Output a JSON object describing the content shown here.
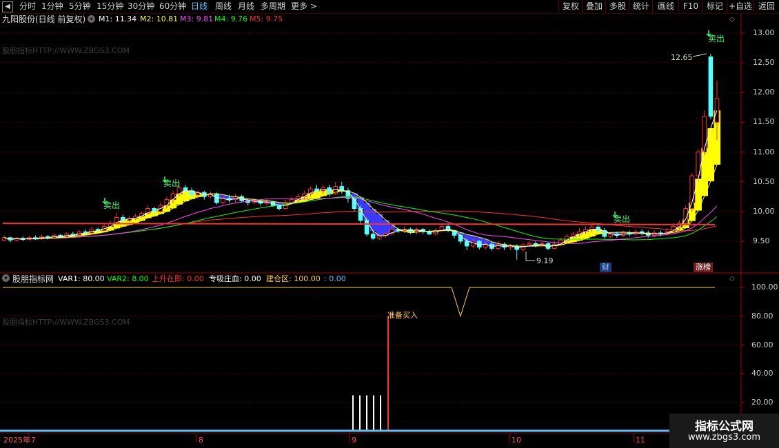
{
  "toolbar": {
    "left_items": [
      "分时",
      "1分钟",
      "5分钟",
      "15分钟",
      "30分钟",
      "60分钟",
      "日线",
      "周线",
      "月线",
      "多周期",
      "更多"
    ],
    "active": "日线",
    "right_items": [
      "复权",
      "叠加",
      "多股",
      "统计",
      "画线",
      "F10",
      "标记",
      "+自选",
      "返回"
    ]
  },
  "main_legend": {
    "stock": "九阳股份(日线 前复权)",
    "m1": "M1: 11.34",
    "m2": "M2: 10.81",
    "m3": "M3: 9.81",
    "m4": "M4: 9.76",
    "m5": "M5: 9.75"
  },
  "sub_legend": {
    "name": "股朋指标网",
    "var1": "VAR1: 80.00",
    "var2": "VAR2: 8.00",
    "rise": "上升在即: 0.00",
    "absorb": "专吸庄血: 0.00",
    "build": "建仓区: 100.00",
    "extra": ": 0.00"
  },
  "watermark": "股朋指标HTTP://WWW.ZBGS3.COM",
  "annotations": {
    "sell": "卖出",
    "high": "12.65",
    "low": "9.19",
    "cai": "财",
    "zhangbang": "涨榜",
    "buy_ready": "准备买入"
  },
  "axis": {
    "price_ticks": [
      "13.00",
      "12.50",
      "12.00",
      "11.50",
      "11.00",
      "10.50",
      "10.00",
      "9.50"
    ],
    "sub_ticks": [
      "100.00",
      "80.00",
      "60.00",
      "40.00",
      "20.00"
    ],
    "dates": [
      "2025年",
      "7",
      "8",
      "9",
      "10",
      "11"
    ]
  },
  "logo": {
    "title": "指标公式网",
    "url": "www.zbgs3.com"
  },
  "colors": {
    "up": "#ff3030",
    "down": "#54ffff",
    "m1": "#ffffff",
    "m2": "#ffff00",
    "m3": "#ff44ff",
    "m4": "#00ff00",
    "m5": "#ff3030",
    "blue_band": "#3a3aff"
  },
  "chart_data": {
    "type": "candlestick",
    "ylim": [
      9.05,
      13.2
    ],
    "candles": [
      [
        9.52,
        9.56,
        9.6,
        9.5
      ],
      [
        9.56,
        9.52,
        9.58,
        9.48
      ],
      [
        9.52,
        9.55,
        9.57,
        9.5
      ],
      [
        9.55,
        9.53,
        9.58,
        9.5
      ],
      [
        9.53,
        9.56,
        9.59,
        9.51
      ],
      [
        9.56,
        9.54,
        9.6,
        9.52
      ],
      [
        9.54,
        9.58,
        9.61,
        9.52
      ],
      [
        9.58,
        9.55,
        9.6,
        9.53
      ],
      [
        9.55,
        9.6,
        9.63,
        9.54
      ],
      [
        9.6,
        9.57,
        9.62,
        9.55
      ],
      [
        9.57,
        9.62,
        9.65,
        9.56
      ],
      [
        9.62,
        9.6,
        9.66,
        9.58
      ],
      [
        9.6,
        9.66,
        9.69,
        9.59
      ],
      [
        9.66,
        9.64,
        9.7,
        9.62
      ],
      [
        9.64,
        9.7,
        9.74,
        9.63
      ],
      [
        9.7,
        9.68,
        9.73,
        9.66
      ],
      [
        9.68,
        9.75,
        9.8,
        9.67
      ],
      [
        9.75,
        9.8,
        9.85,
        9.73
      ],
      [
        9.8,
        9.9,
        9.98,
        9.78
      ],
      [
        9.9,
        9.85,
        9.95,
        9.82
      ],
      [
        9.85,
        9.88,
        9.92,
        9.83
      ],
      [
        9.88,
        9.92,
        9.96,
        9.86
      ],
      [
        9.92,
        9.97,
        10.0,
        9.9
      ],
      [
        9.97,
        10.05,
        10.1,
        9.95
      ],
      [
        10.05,
        10.0,
        10.08,
        9.97
      ],
      [
        10.0,
        10.1,
        10.15,
        9.98
      ],
      [
        10.1,
        10.2,
        10.25,
        10.05
      ],
      [
        10.2,
        10.3,
        10.35,
        10.15
      ],
      [
        10.3,
        10.4,
        10.5,
        10.25
      ],
      [
        10.4,
        10.35,
        10.45,
        10.3
      ],
      [
        10.35,
        10.28,
        10.4,
        10.25
      ],
      [
        10.28,
        10.32,
        10.36,
        10.22
      ],
      [
        10.32,
        10.25,
        10.35,
        10.2
      ],
      [
        10.25,
        10.3,
        10.34,
        10.22
      ],
      [
        10.3,
        10.15,
        10.32,
        10.12
      ],
      [
        10.15,
        10.22,
        10.26,
        10.12
      ],
      [
        10.22,
        10.2,
        10.28,
        10.15
      ],
      [
        10.2,
        10.25,
        10.3,
        10.15
      ],
      [
        10.25,
        10.18,
        10.28,
        10.15
      ],
      [
        10.18,
        10.15,
        10.22,
        10.1
      ],
      [
        10.15,
        10.18,
        10.22,
        10.12
      ],
      [
        10.18,
        10.14,
        10.2,
        10.1
      ],
      [
        10.14,
        10.16,
        10.2,
        10.1
      ],
      [
        10.16,
        10.1,
        10.18,
        10.08
      ],
      [
        10.1,
        10.05,
        10.12,
        10.02
      ],
      [
        10.05,
        10.15,
        10.2,
        10.03
      ],
      [
        10.15,
        10.2,
        10.25,
        10.1
      ],
      [
        10.2,
        10.25,
        10.3,
        10.15
      ],
      [
        10.25,
        10.3,
        10.35,
        10.2
      ],
      [
        10.3,
        10.38,
        10.42,
        10.25
      ],
      [
        10.38,
        10.35,
        10.45,
        10.3
      ],
      [
        10.35,
        10.4,
        10.45,
        10.3
      ],
      [
        10.4,
        10.3,
        10.45,
        10.25
      ],
      [
        10.3,
        10.42,
        10.5,
        10.28
      ],
      [
        10.42,
        10.35,
        10.5,
        10.3
      ],
      [
        10.35,
        10.22,
        10.4,
        10.15
      ],
      [
        10.22,
        10.05,
        10.25,
        10.0
      ],
      [
        10.05,
        9.85,
        10.1,
        9.8
      ],
      [
        9.85,
        9.62,
        9.9,
        9.58
      ],
      [
        9.62,
        9.55,
        9.68,
        9.52
      ],
      [
        9.55,
        9.6,
        9.63,
        9.52
      ],
      [
        9.6,
        9.63,
        9.66,
        9.56
      ],
      [
        9.63,
        9.7,
        9.74,
        9.6
      ],
      [
        9.7,
        9.68,
        9.73,
        9.64
      ],
      [
        9.68,
        9.7,
        9.74,
        9.64
      ],
      [
        9.7,
        9.66,
        9.73,
        9.62
      ],
      [
        9.66,
        9.7,
        9.73,
        9.62
      ],
      [
        9.7,
        9.66,
        9.72,
        9.62
      ],
      [
        9.66,
        9.62,
        9.7,
        9.6
      ],
      [
        9.62,
        9.68,
        9.72,
        9.6
      ],
      [
        9.68,
        9.75,
        9.78,
        9.65
      ],
      [
        9.75,
        9.68,
        9.78,
        9.65
      ],
      [
        9.68,
        9.6,
        9.7,
        9.55
      ],
      [
        9.6,
        9.5,
        9.65,
        9.45
      ],
      [
        9.5,
        9.42,
        9.55,
        9.35
      ],
      [
        9.42,
        9.5,
        9.55,
        9.38
      ],
      [
        9.5,
        9.4,
        9.52,
        9.36
      ],
      [
        9.4,
        9.45,
        9.5,
        9.36
      ],
      [
        9.45,
        9.38,
        9.5,
        9.34
      ],
      [
        9.38,
        9.45,
        9.5,
        9.35
      ],
      [
        9.45,
        9.4,
        9.48,
        9.35
      ],
      [
        9.4,
        9.42,
        9.46,
        9.35
      ],
      [
        9.42,
        9.36,
        9.45,
        9.19
      ],
      [
        9.36,
        9.44,
        9.48,
        9.33
      ],
      [
        9.44,
        9.46,
        9.5,
        9.4
      ],
      [
        9.46,
        9.42,
        9.5,
        9.4
      ],
      [
        9.42,
        9.46,
        9.5,
        9.4
      ],
      [
        9.46,
        9.38,
        9.48,
        9.35
      ],
      [
        9.38,
        9.45,
        9.5,
        9.36
      ],
      [
        9.45,
        9.52,
        9.56,
        9.42
      ],
      [
        9.52,
        9.58,
        9.62,
        9.48
      ],
      [
        9.58,
        9.62,
        9.66,
        9.55
      ],
      [
        9.62,
        9.66,
        9.72,
        9.58
      ],
      [
        9.66,
        9.7,
        9.75,
        9.62
      ],
      [
        9.7,
        9.74,
        9.8,
        9.66
      ],
      [
        9.74,
        9.68,
        9.78,
        9.64
      ],
      [
        9.68,
        9.58,
        9.72,
        9.55
      ],
      [
        9.58,
        9.62,
        9.66,
        9.55
      ],
      [
        9.62,
        9.6,
        9.66,
        9.56
      ],
      [
        9.6,
        9.64,
        9.68,
        9.57
      ],
      [
        9.64,
        9.62,
        9.68,
        9.58
      ],
      [
        9.62,
        9.66,
        9.7,
        9.59
      ],
      [
        9.66,
        9.64,
        9.7,
        9.6
      ],
      [
        9.64,
        9.6,
        9.68,
        9.56
      ],
      [
        9.6,
        9.64,
        9.68,
        9.57
      ],
      [
        9.64,
        9.62,
        9.68,
        9.58
      ],
      [
        9.62,
        9.66,
        9.72,
        9.6
      ],
      [
        9.66,
        9.75,
        9.8,
        9.62
      ],
      [
        9.75,
        9.8,
        9.85,
        9.7
      ],
      [
        9.8,
        10.05,
        10.1,
        9.78
      ],
      [
        10.05,
        10.6,
        10.65,
        10.0
      ],
      [
        10.6,
        11.0,
        11.05,
        10.5
      ],
      [
        11.0,
        11.6,
        11.7,
        10.95
      ],
      [
        12.6,
        11.6,
        12.65,
        11.55
      ],
      [
        11.5,
        11.9,
        12.2,
        11.2
      ]
    ],
    "sub_series": {
      "var1_line": "≈100 flat with a dip to 80",
      "buy_ready_level": 80
    }
  }
}
